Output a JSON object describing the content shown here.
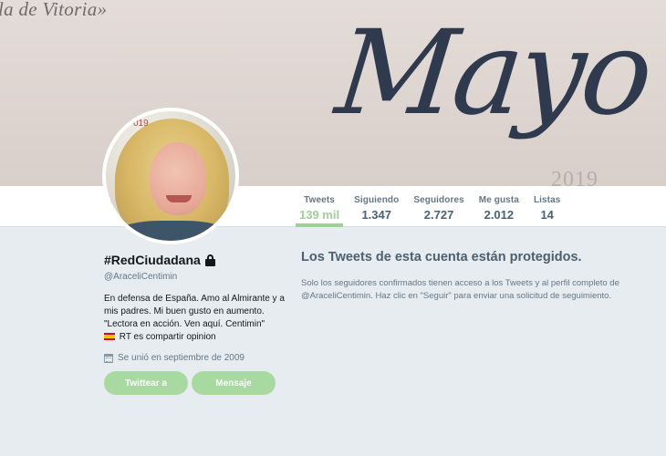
{
  "banner": {
    "top_text": "la de Vitoria»",
    "script_text": "Mayo",
    "year_text": "2019"
  },
  "avatar": {
    "tag": "019"
  },
  "stats": [
    {
      "label": "Tweets",
      "value": "139 mil",
      "active": true
    },
    {
      "label": "Siguiendo",
      "value": "1.347"
    },
    {
      "label": "Seguidores",
      "value": "2.727"
    },
    {
      "label": "Me gusta",
      "value": "2.012"
    },
    {
      "label": "Listas",
      "value": "14"
    }
  ],
  "profile": {
    "name": "#RedCiudadana",
    "handle": "@AraceliCentimin",
    "bio_line1": "En defensa de España. Amo al Almirante y a mis padres. Mi buen gusto en aumento. \"Lectora en acción. Ven aquí. Centimin\"",
    "bio_line2": "RT es compartir opinion",
    "joined": "Se unió en septiembre de 2009",
    "tweet_button": "Twittear a",
    "message_button": "Mensaje"
  },
  "notice": {
    "title": "Los Tweets de esta cuenta están protegidos.",
    "body": "Solo los seguidores confirmados tienen acceso a los Tweets y al perfil completo de @AraceliCentimin. Haz clic en \"Seguir\" para enviar una solicitud de seguimiento."
  },
  "colors": {
    "accent": "#9ed198",
    "button": "#a8d9a0",
    "background": "#e6ecf0"
  }
}
